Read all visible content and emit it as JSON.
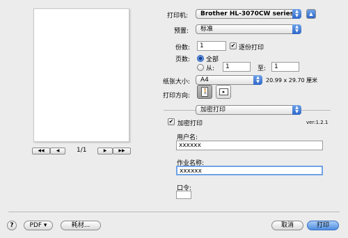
{
  "printer": {
    "label": "打印机:",
    "value": "Brother HL-3070CW series"
  },
  "presets": {
    "label": "预置:",
    "value": "标准"
  },
  "copies": {
    "label": "份数:",
    "value": "1",
    "collate_label": "逐份打印",
    "collate_checked": true
  },
  "pages": {
    "label": "页数:",
    "all_label": "全部",
    "from_label": "从:",
    "from_value": "1",
    "to_label": "至:",
    "to_value": "1"
  },
  "paper": {
    "label": "纸张大小:",
    "value": "A4",
    "size_text": "20.99 x 29.70 厘米"
  },
  "orientation": {
    "label": "打印方向:"
  },
  "panel": {
    "value": "加密打印"
  },
  "secure": {
    "checkbox_label": "加密打印",
    "version": "ver:1.2.1",
    "user_label": "用户名:",
    "user_value": "xxxxxx",
    "job_label": "作业名称:",
    "job_value": "xxxxxx",
    "password_label": "口令:",
    "password_value": ""
  },
  "preview": {
    "page_indicator": "1/1"
  },
  "bottom": {
    "help": "?",
    "pdf_label": "PDF ▾",
    "supplies_label": "耗材...",
    "cancel_label": "取消",
    "print_label": "打印"
  }
}
